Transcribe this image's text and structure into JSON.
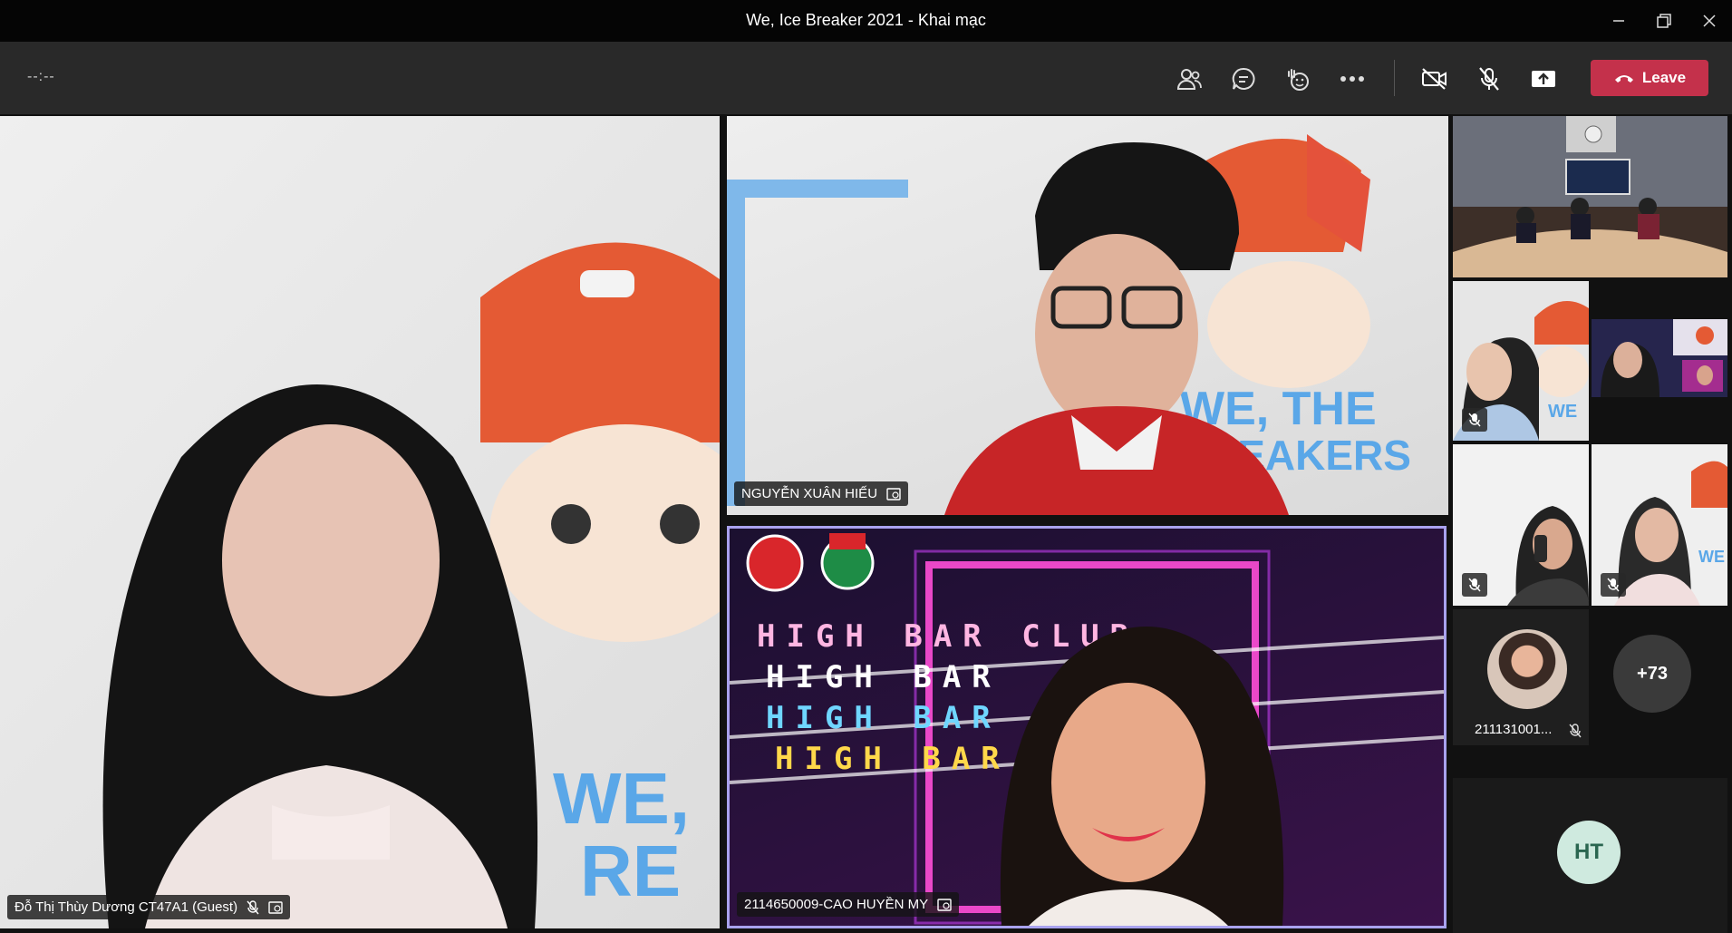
{
  "window": {
    "title": "We, Ice Breaker 2021 - Khai mạc",
    "minimize_icon": "minimize-icon",
    "restore_icon": "restore-icon",
    "close_icon": "close-icon"
  },
  "toolbar": {
    "timer": "--:--",
    "leave_label": "Leave",
    "colors": {
      "leave": "#c4314b",
      "bar": "#292929"
    }
  },
  "participants": {
    "main_left": {
      "name": "Đỗ Thị Thùy Dương CT47A1 (Guest)"
    },
    "top_right": {
      "name": "NGUYỄN XUÂN HIẾU"
    },
    "bottom_right": {
      "name": "2114650009-CAO HUYỀN MY",
      "overlay_text": "HIGH BAR CLUB",
      "overlay_rows": [
        "HIGH BAR",
        "HIGH BAR",
        "HIGH BAR"
      ]
    },
    "small_avatar": {
      "name": "211131001..."
    },
    "more_count": "+73",
    "initials": "HT"
  }
}
